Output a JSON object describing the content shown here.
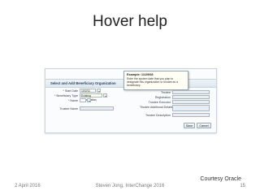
{
  "slide": {
    "title": "Hover help",
    "courtesy": "Courtesy Oracle",
    "footer_date": "2 April 2016",
    "footer_center": "Steven Jong, InterChange 2016",
    "page_number": "15"
  },
  "screenshot": {
    "section_title": "Select and Add Beneficiary Organization",
    "tooltip": {
      "heading": "Example: 11/29/08",
      "body": "Enter the system date that you plan to designate this organization or trustee as a beneficiary."
    },
    "left_fields": [
      {
        "label": "* Start Date",
        "value": "10/2/11"
      },
      {
        "label": "* Beneficiary Type",
        "value": "Existing organization"
      },
      {
        "label": "* Name",
        "value": ""
      },
      {
        "label": "Trustee Name",
        "value": ""
      }
    ],
    "right_fields": [
      {
        "label": "Trustee"
      },
      {
        "label": "Registration"
      },
      {
        "label": "Trustee Executor"
      },
      {
        "label": "Trustee Additional Details"
      },
      {
        "label": "Trustee Description"
      }
    ],
    "buttons": {
      "save": "Save",
      "cancel": "Cancel"
    }
  }
}
